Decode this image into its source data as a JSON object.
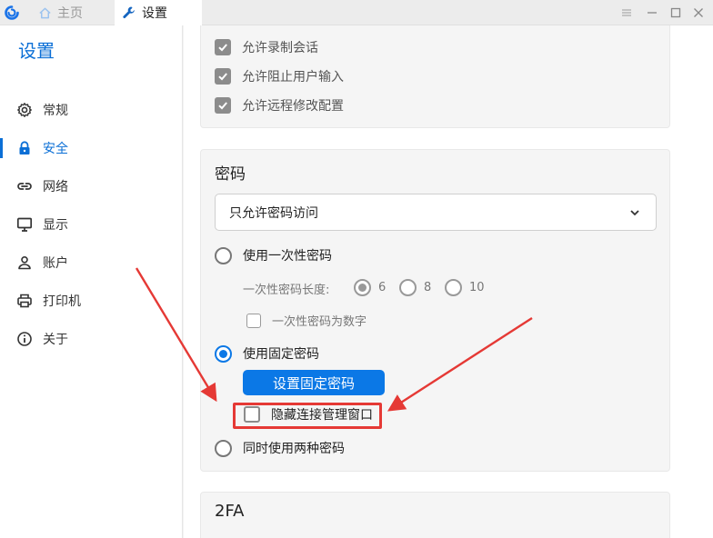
{
  "titlebar": {
    "tabs": [
      {
        "label": "主页",
        "icon": "home-icon",
        "active": false
      },
      {
        "label": "设置",
        "icon": "wrench-icon",
        "active": true
      }
    ]
  },
  "sidebar": {
    "title": "设置",
    "items": [
      {
        "label": "常规",
        "icon": "gear-icon",
        "active": false
      },
      {
        "label": "安全",
        "icon": "lock-icon",
        "active": true
      },
      {
        "label": "网络",
        "icon": "link-icon",
        "active": false
      },
      {
        "label": "显示",
        "icon": "monitor-icon",
        "active": false
      },
      {
        "label": "账户",
        "icon": "user-icon",
        "active": false
      },
      {
        "label": "打印机",
        "icon": "printer-icon",
        "active": false
      },
      {
        "label": "关于",
        "icon": "info-icon",
        "active": false
      }
    ]
  },
  "permissions": {
    "items": [
      {
        "label": "允许录制会话",
        "checked": true
      },
      {
        "label": "允许阻止用户输入",
        "checked": true
      },
      {
        "label": "允许远程修改配置",
        "checked": true
      }
    ]
  },
  "password": {
    "title": "密码",
    "access_mode": "只允许密码访问",
    "one_time": {
      "label": "使用一次性密码",
      "selected": false,
      "length_label": "一次性密码长度:",
      "lengths": [
        "6",
        "8",
        "10"
      ],
      "selected_length": "6",
      "numeric_label": "一次性密码为数字",
      "numeric_checked": false
    },
    "fixed": {
      "label": "使用固定密码",
      "selected": true,
      "button_label": "设置固定密码",
      "hide_cm_label": "隐藏连接管理窗口",
      "hide_cm_checked": false
    },
    "both": {
      "label": "同时使用两种密码",
      "selected": false
    }
  },
  "twofa": {
    "title": "2FA"
  },
  "colors": {
    "accent": "#0b78e6",
    "highlight": "#e53935"
  }
}
